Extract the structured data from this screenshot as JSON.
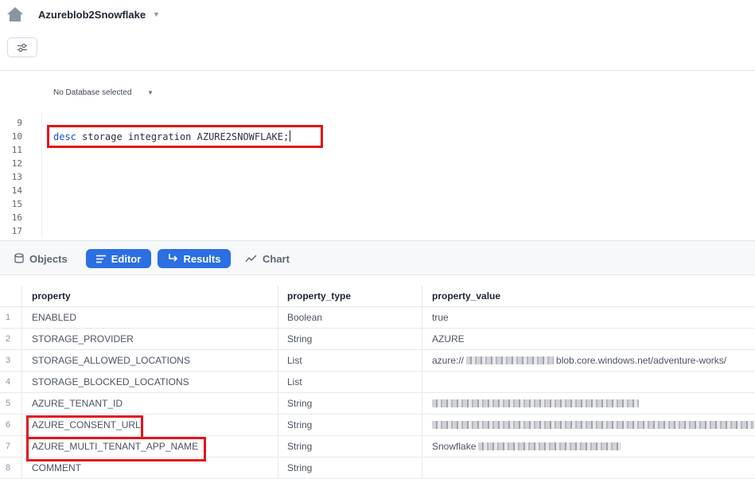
{
  "header": {
    "title": "Azureblob2Snowflake",
    "database_label": "No Database selected"
  },
  "editor": {
    "line_numbers": [
      "9",
      "10",
      "11",
      "12",
      "13",
      "14",
      "15",
      "16",
      "17"
    ],
    "code": {
      "keyword": "desc",
      "rest": " storage integration AZURE2SNOWFLAKE;"
    }
  },
  "toolbar": {
    "objects": "Objects",
    "editor": "Editor",
    "results": "Results",
    "chart": "Chart"
  },
  "results": {
    "columns": [
      "property",
      "property_type",
      "property_value"
    ],
    "rows": [
      {
        "index": "1",
        "property": "ENABLED",
        "type": "Boolean",
        "value": "true"
      },
      {
        "index": "2",
        "property": "STORAGE_PROVIDER",
        "type": "String",
        "value": "AZURE"
      },
      {
        "index": "3",
        "property": "STORAGE_ALLOWED_LOCATIONS",
        "type": "List",
        "value_prefix": "azure://",
        "value_suffix": "blob.core.windows.net/adventure-works/"
      },
      {
        "index": "4",
        "property": "STORAGE_BLOCKED_LOCATIONS",
        "type": "List",
        "value": ""
      },
      {
        "index": "5",
        "property": "AZURE_TENANT_ID",
        "type": "String",
        "value": ""
      },
      {
        "index": "6",
        "property": "AZURE_CONSENT_URL",
        "type": "String",
        "value": ""
      },
      {
        "index": "7",
        "property": "AZURE_MULTI_TENANT_APP_NAME",
        "type": "String",
        "value_prefix": "Snowflake"
      },
      {
        "index": "8",
        "property": "COMMENT",
        "type": "String",
        "value": ""
      }
    ]
  },
  "colors": {
    "accent": "#2b6fe3",
    "highlight": "#e3141b",
    "keyword": "#1f4fd1"
  }
}
